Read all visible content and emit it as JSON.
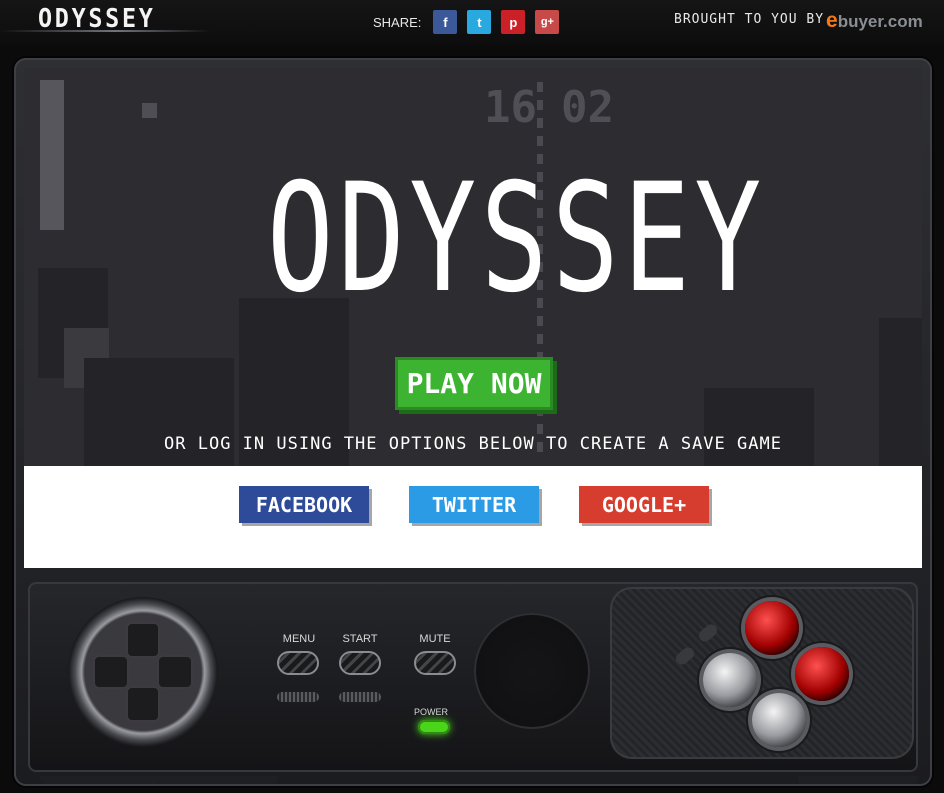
{
  "header": {
    "logo": "ODYSSEY",
    "share_label": "SHARE:",
    "share_icons": [
      {
        "name": "facebook-icon",
        "glyph": "f",
        "color": "#3b5998"
      },
      {
        "name": "twitter-icon",
        "glyph": "t",
        "color": "#2aa9e0"
      },
      {
        "name": "pinterest-icon",
        "glyph": "p",
        "color": "#cb2027"
      },
      {
        "name": "google-plus-icon",
        "glyph": "g+",
        "color": "#c84a48"
      }
    ],
    "brought_by": "BROUGHT TO YOU BY",
    "sponsor_initial": "e",
    "sponsor_rest": "buyer.com"
  },
  "screen": {
    "score_left": "16",
    "score_right": "02",
    "title": "ODYSSEY",
    "play_label": "PLAY NOW",
    "hint": "OR LOG IN USING THE OPTIONS BELOW TO CREATE A SAVE GAME",
    "login_buttons": [
      {
        "label": "FACEBOOK",
        "color": "#2e4b99"
      },
      {
        "label": "TWITTER",
        "color": "#2b9be6"
      },
      {
        "label": "GOOGLE+",
        "color": "#d73d2e"
      }
    ]
  },
  "controls": {
    "menu_label": "MENU",
    "start_label": "START",
    "mute_label": "MUTE",
    "power_label": "POWER"
  }
}
